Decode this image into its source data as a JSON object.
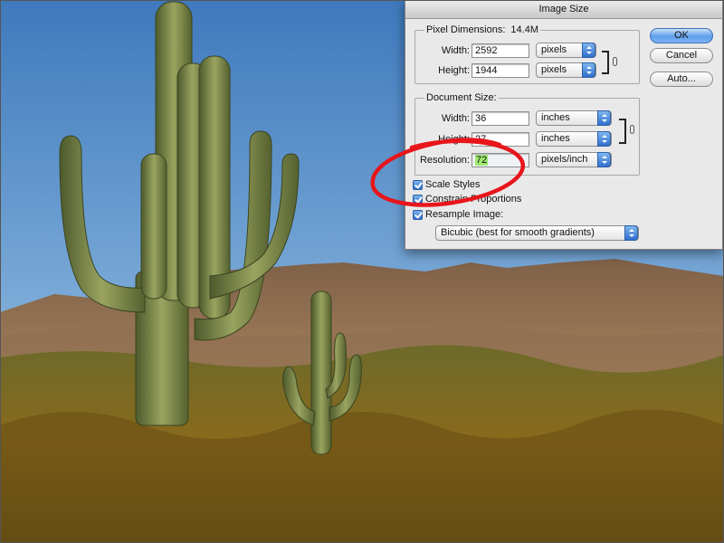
{
  "dialog": {
    "title": "Image Size",
    "pixel_dimensions": {
      "label": "Pixel Dimensions:",
      "size": "14.4M",
      "width_label": "Width:",
      "width_value": "2592",
      "width_unit": "pixels",
      "height_label": "Height:",
      "height_value": "1944",
      "height_unit": "pixels"
    },
    "document_size": {
      "label": "Document Size:",
      "width_label": "Width:",
      "width_value": "36",
      "width_unit": "inches",
      "height_label": "Height:",
      "height_value": "27",
      "height_unit": "inches",
      "resolution_label": "Resolution:",
      "resolution_value": "72",
      "resolution_unit": "pixels/inch"
    },
    "buttons": {
      "ok": "OK",
      "cancel": "Cancel",
      "auto": "Auto..."
    },
    "options": {
      "scale_styles": "Scale Styles",
      "constrain_proportions": "Constrain Proportions",
      "resample_image": "Resample Image:",
      "resample_method": "Bicubic (best for smooth gradients)"
    }
  },
  "colors": {
    "annotation": "#e8151b",
    "resolution_highlight": "#9fe870",
    "accent": "#2f6fcd"
  }
}
